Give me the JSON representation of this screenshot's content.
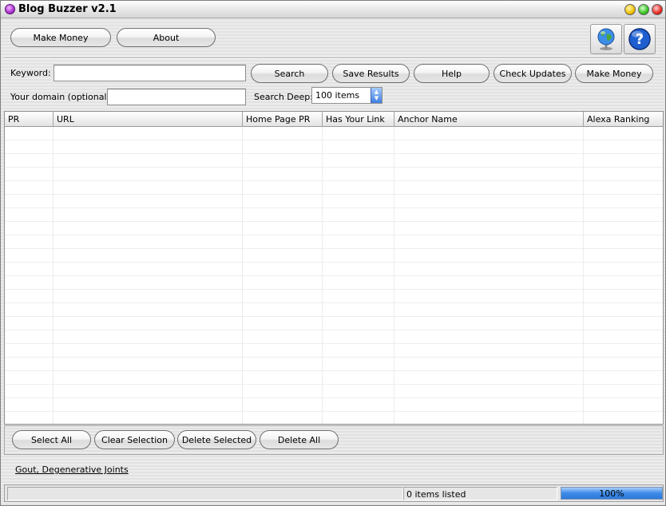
{
  "window": {
    "title": "Blog Buzzer v2.1"
  },
  "header": {
    "make_money_label": "Make Money",
    "about_label": "About",
    "icons": [
      "globe-icon",
      "help-icon"
    ]
  },
  "search": {
    "keyword_label": "Keyword:",
    "keyword_value": "",
    "domain_label": "Your domain (optionally):",
    "domain_value": "",
    "search_deep_label": "Search Deep:",
    "search_deep_value": "100 items"
  },
  "toolbar": {
    "search_label": "Search",
    "save_results_label": "Save Results",
    "help_label": "Help",
    "check_updates_label": "Check Updates",
    "make_money_label": "Make Money"
  },
  "table": {
    "columns": [
      "PR",
      "URL",
      "Home Page PR",
      "Has Your Link",
      "Anchor Name",
      "Alexa Ranking"
    ],
    "rows": []
  },
  "actions": {
    "select_all_label": "Select All",
    "clear_selection_label": "Clear Selection",
    "delete_selected_label": "Delete Selected",
    "delete_all_label": "Delete All"
  },
  "footer_link": "Gout, Degenerative Joints",
  "status": {
    "items_listed": "0 items listed",
    "progress_text": "100%",
    "progress_value": 1.0
  },
  "colors": {
    "progress_fill": "#3c8ae8",
    "select_arrow": "#3f7fe0"
  }
}
